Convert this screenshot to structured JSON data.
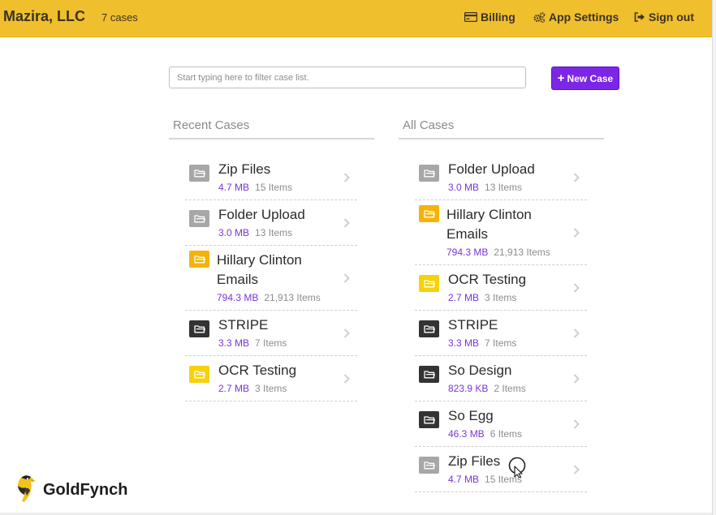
{
  "header": {
    "company": "Mazira, LLC",
    "case_count": "7 cases",
    "billing_label": "Billing",
    "settings_label": "App Settings",
    "signout_label": "Sign out",
    "bg_color": "#f0bf2d"
  },
  "search": {
    "placeholder": "Start typing here to filter case list."
  },
  "new_case": {
    "label": "New Case",
    "color": "#7c26e6"
  },
  "recent": {
    "title": "Recent Cases",
    "items": [
      {
        "name": "Zip Files",
        "size": "4.7 MB",
        "count": "15 Items",
        "color": "#a7a7a7"
      },
      {
        "name": "Folder Upload",
        "size": "3.0 MB",
        "count": "13 Items",
        "color": "#a7a7a7"
      },
      {
        "name": "Hillary Clinton Emails",
        "size": "794.3 MB",
        "count": "21,913 Items",
        "color": "#f5b30a"
      },
      {
        "name": "STRIPE",
        "size": "3.3 MB",
        "count": "7 Items",
        "color": "#333333"
      },
      {
        "name": "OCR Testing",
        "size": "2.7 MB",
        "count": "3 Items",
        "color": "#f5d20a"
      }
    ]
  },
  "all": {
    "title": "All Cases",
    "items": [
      {
        "name": "Folder Upload",
        "size": "3.0 MB",
        "count": "13 Items",
        "color": "#a7a7a7"
      },
      {
        "name": "Hillary Clinton Emails",
        "size": "794.3 MB",
        "count": "21,913 Items",
        "color": "#f5b30a"
      },
      {
        "name": "OCR Testing",
        "size": "2.7 MB",
        "count": "3 Items",
        "color": "#f5d20a"
      },
      {
        "name": "STRIPE",
        "size": "3.3 MB",
        "count": "7 Items",
        "color": "#333333"
      },
      {
        "name": "So Design",
        "size": "823.9 KB",
        "count": "2 Items",
        "color": "#333333"
      },
      {
        "name": "So Egg",
        "size": "46.3 MB",
        "count": "6 Items",
        "color": "#333333"
      },
      {
        "name": "Zip Files",
        "size": "4.7 MB",
        "count": "15 Items",
        "color": "#a7a7a7"
      }
    ]
  },
  "footer": {
    "logo_text": "GoldFynch"
  }
}
